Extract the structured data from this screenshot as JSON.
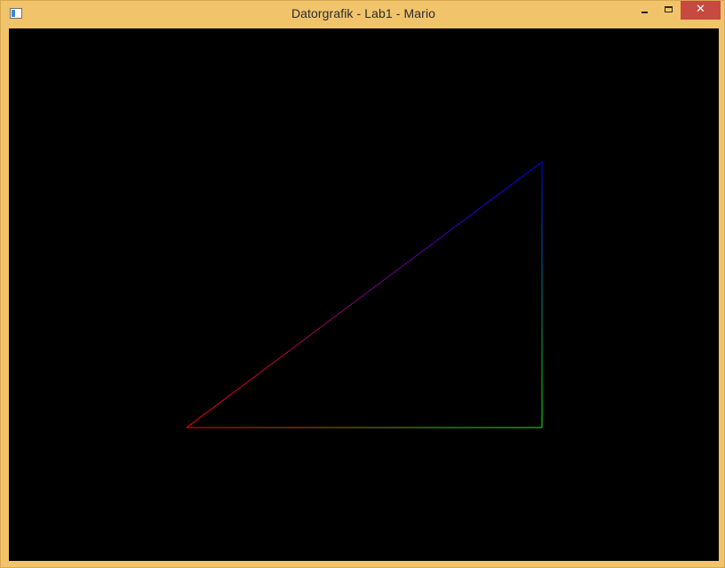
{
  "window": {
    "title": "Datorgrafik - Lab1 - Mario",
    "frame_color": "#f1c46b",
    "close_button_color": "#c7493f",
    "icons": {
      "app": "app-window-icon",
      "minimize": "minimize-icon",
      "maximize": "maximize-icon",
      "close": "close-icon"
    },
    "close_glyph": "✕"
  },
  "canvas": {
    "background": "#000000",
    "triangle": {
      "vertices": [
        {
          "name": "left",
          "color": "#ff0000"
        },
        {
          "name": "right",
          "color": "#00ff00"
        },
        {
          "name": "top",
          "color": "#0000ff"
        }
      ]
    }
  }
}
